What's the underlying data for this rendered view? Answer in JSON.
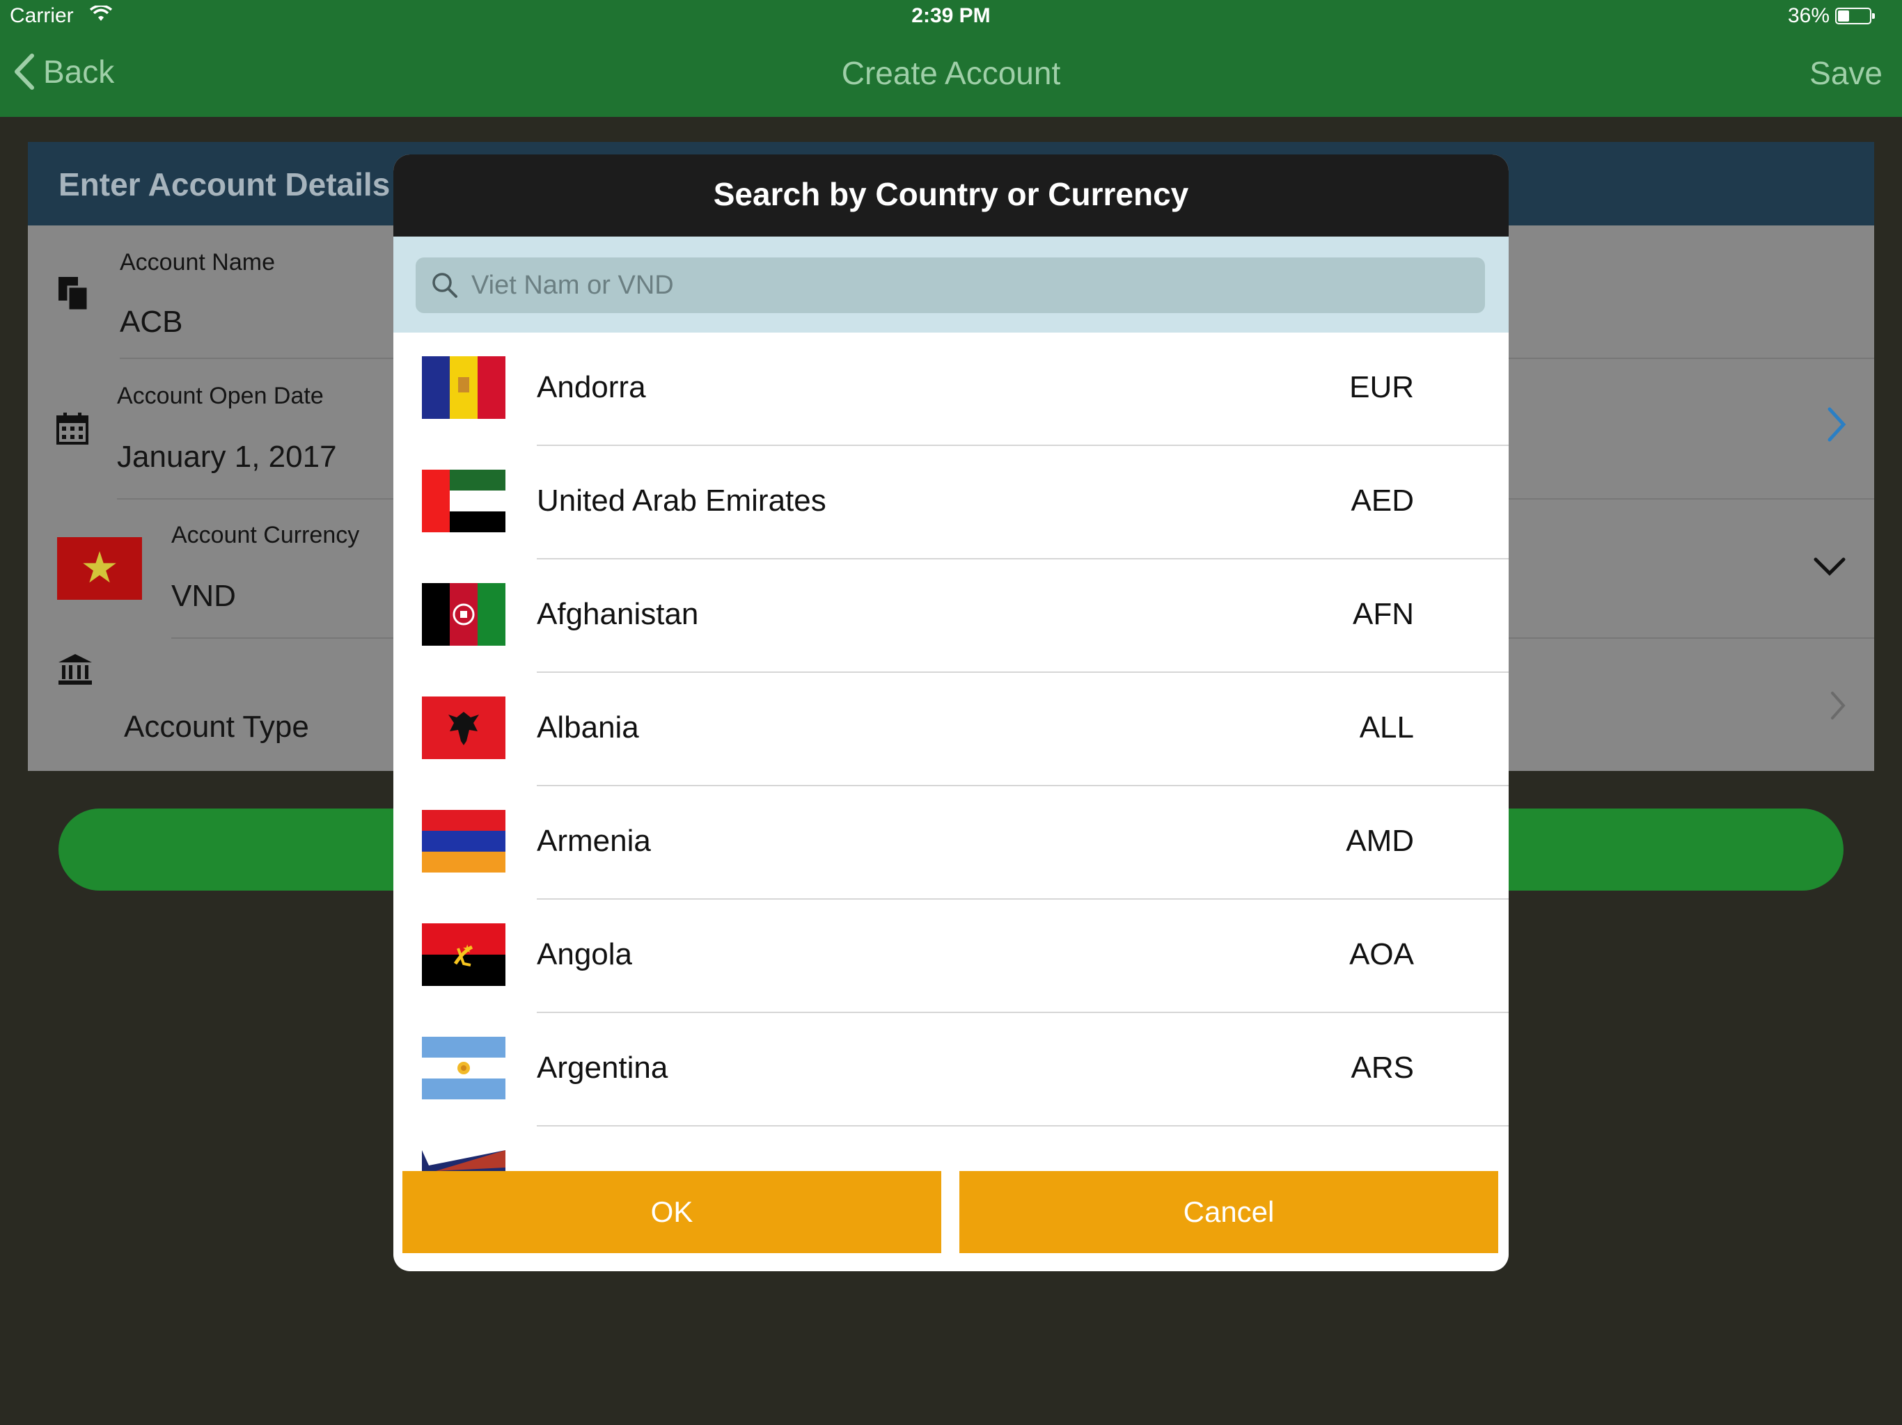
{
  "status": {
    "carrier": "Carrier",
    "time": "2:39 PM",
    "battery": "36%"
  },
  "nav": {
    "back": "Back",
    "title": "Create Account",
    "save": "Save"
  },
  "form": {
    "header": "Enter Account Details",
    "account_name_label": "Account Name",
    "account_name_value": "ACB",
    "open_date_label": "Account Open Date",
    "open_date_value": "January 1, 2017",
    "currency_label": "Account Currency",
    "currency_value": "VND",
    "account_type_label": "Account Type"
  },
  "modal": {
    "title": "Search by Country or Currency",
    "search_placeholder": "Viet Nam or VND",
    "items": [
      {
        "country": "Andorra",
        "code": "EUR"
      },
      {
        "country": "United Arab Emirates",
        "code": "AED"
      },
      {
        "country": "Afghanistan",
        "code": "AFN"
      },
      {
        "country": "Albania",
        "code": "ALL"
      },
      {
        "country": "Armenia",
        "code": "AMD"
      },
      {
        "country": "Angola",
        "code": "AOA"
      },
      {
        "country": "Argentina",
        "code": "ARS"
      }
    ],
    "ok_label": "OK",
    "cancel_label": "Cancel"
  },
  "colors": {
    "nav_green": "#1f7331",
    "button_orange": "#eea20b",
    "modal_header": "#1c1c1c",
    "form_header": "#1f3a4d",
    "accent_blue": "#2b7fc4"
  },
  "icons": [
    "back-chevron-icon",
    "wifi-icon",
    "battery-icon",
    "document-icon",
    "calendar-icon",
    "bank-icon",
    "chevron-right-icon",
    "chevron-down-icon",
    "search-icon"
  ]
}
